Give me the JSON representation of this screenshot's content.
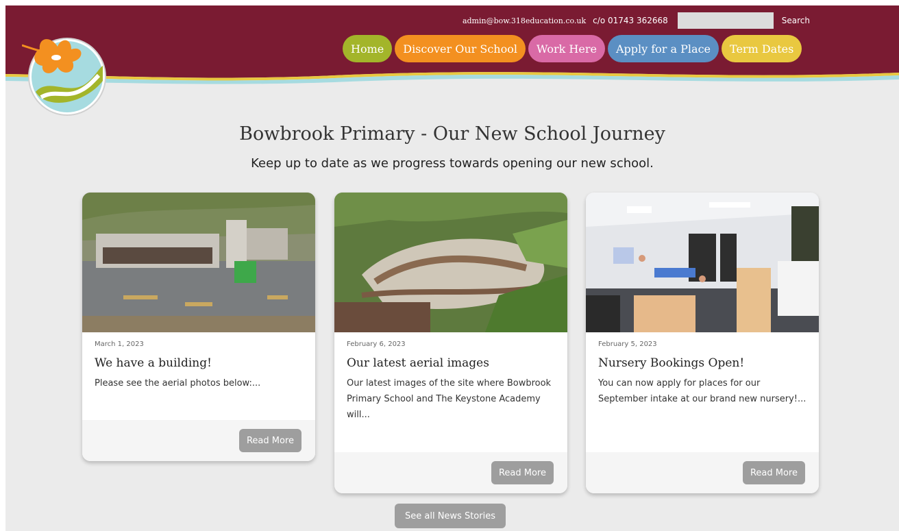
{
  "header": {
    "email": "admin@bow.318education.co.uk",
    "phone": "c/o 01743 362668",
    "search_placeholder": "",
    "search_label": "Search",
    "colors": {
      "brand": "#7a1b32"
    }
  },
  "nav": [
    {
      "label": "Home",
      "color": "#a3b52a"
    },
    {
      "label": "Discover Our School",
      "color": "#f39020"
    },
    {
      "label": "Work Here",
      "color": "#d96aa6"
    },
    {
      "label": "Apply for a Place",
      "color": "#5b8fc3"
    },
    {
      "label": "Term Dates",
      "color": "#e9c840"
    }
  ],
  "hero": {
    "title": "Bowbrook Primary - Our New School Journey",
    "subtitle": "Keep up to date as we progress towards opening our new school."
  },
  "cards": [
    {
      "date": "March 1, 2023",
      "title": "We have a building!",
      "excerpt": "Please see the aerial photos below:...",
      "button": "Read More",
      "image": "aerial photo of school building under construction"
    },
    {
      "date": "February 6, 2023",
      "title": "Our latest aerial images",
      "excerpt": "Our latest images of the site where Bowbrook Primary School and The Keystone Academy will...",
      "button": "Read More",
      "image": "aerial photo of construction site among fields"
    },
    {
      "date": "February 5, 2023",
      "title": "Nursery Bookings Open!",
      "excerpt": "You can now apply for places for our September intake at our brand new nursery!...",
      "button": "Read More",
      "image": "rendering of nursery classroom interior"
    }
  ],
  "see_all_label": "See all News Stories"
}
